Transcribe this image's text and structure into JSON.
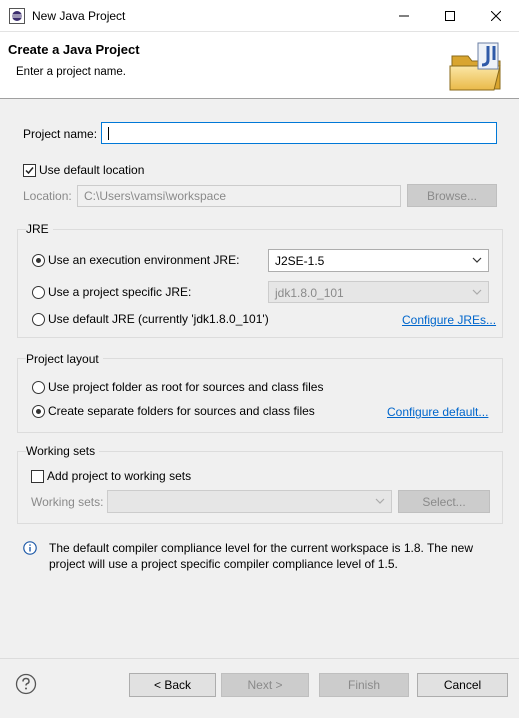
{
  "window": {
    "title": "New Java Project"
  },
  "banner": {
    "title": "Create a Java Project",
    "message": "Enter a project name."
  },
  "project": {
    "name_label": "Project name:",
    "name_value": "",
    "use_default_location_label": "Use default location",
    "use_default_location_checked": true,
    "location_label": "Location:",
    "location_value": "C:\\Users\\vamsi\\workspace",
    "browse_label": "Browse..."
  },
  "jre": {
    "group_title": "JRE",
    "option_env_label": "Use an execution environment JRE:",
    "option_env_value": "J2SE-1.5",
    "option_specific_label": "Use a project specific JRE:",
    "option_specific_value": "jdk1.8.0_101",
    "option_default_label": "Use default JRE (currently 'jdk1.8.0_101')",
    "configure_link": "Configure JREs...",
    "selected": "env"
  },
  "layout": {
    "group_title": "Project layout",
    "option_root_label": "Use project folder as root for sources and class files",
    "option_separate_label": "Create separate folders for sources and class files",
    "configure_link": "Configure default...",
    "selected": "separate"
  },
  "working_sets": {
    "group_title": "Working sets",
    "add_label": "Add project to working sets",
    "add_checked": false,
    "sets_label": "Working sets:",
    "sets_value": "",
    "select_label": "Select..."
  },
  "info": {
    "message": "The default compiler compliance level for the current workspace is 1.8. The new project will use a project specific compiler compliance level of 1.5."
  },
  "footer": {
    "back_label": "< Back",
    "next_label": "Next >",
    "finish_label": "Finish",
    "cancel_label": "Cancel"
  },
  "colors": {
    "link": "#0066cc",
    "focus": "#0078d7",
    "info_icon": "#1e5aa8"
  }
}
